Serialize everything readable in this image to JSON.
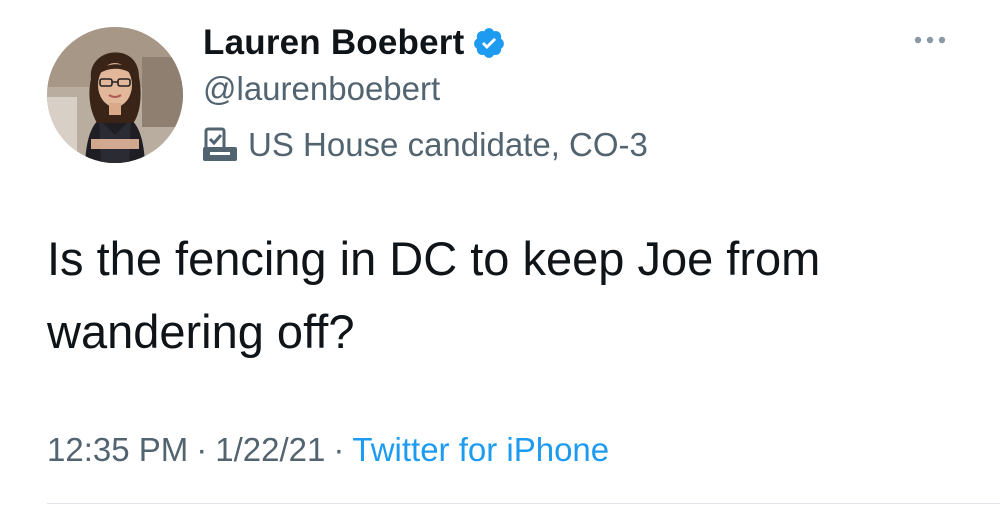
{
  "author": {
    "display_name": "Lauren Boebert",
    "handle": "@laurenboebert",
    "verified": true,
    "label": "US House candidate, CO-3",
    "label_icon": "ballot-box-icon"
  },
  "tweet": {
    "text": "Is the fencing in DC to keep Joe from wandering off?",
    "time": "12:35 PM",
    "date": "1/22/21",
    "source": "Twitter for iPhone"
  },
  "meta": {
    "separator": "·"
  },
  "colors": {
    "text_primary": "#0f1419",
    "text_secondary": "#536471",
    "link": "#1d9bf0",
    "verified_badge": "#1d9bf0"
  },
  "icons": {
    "more": "more-horizontal-icon",
    "verified": "verified-badge-icon"
  }
}
